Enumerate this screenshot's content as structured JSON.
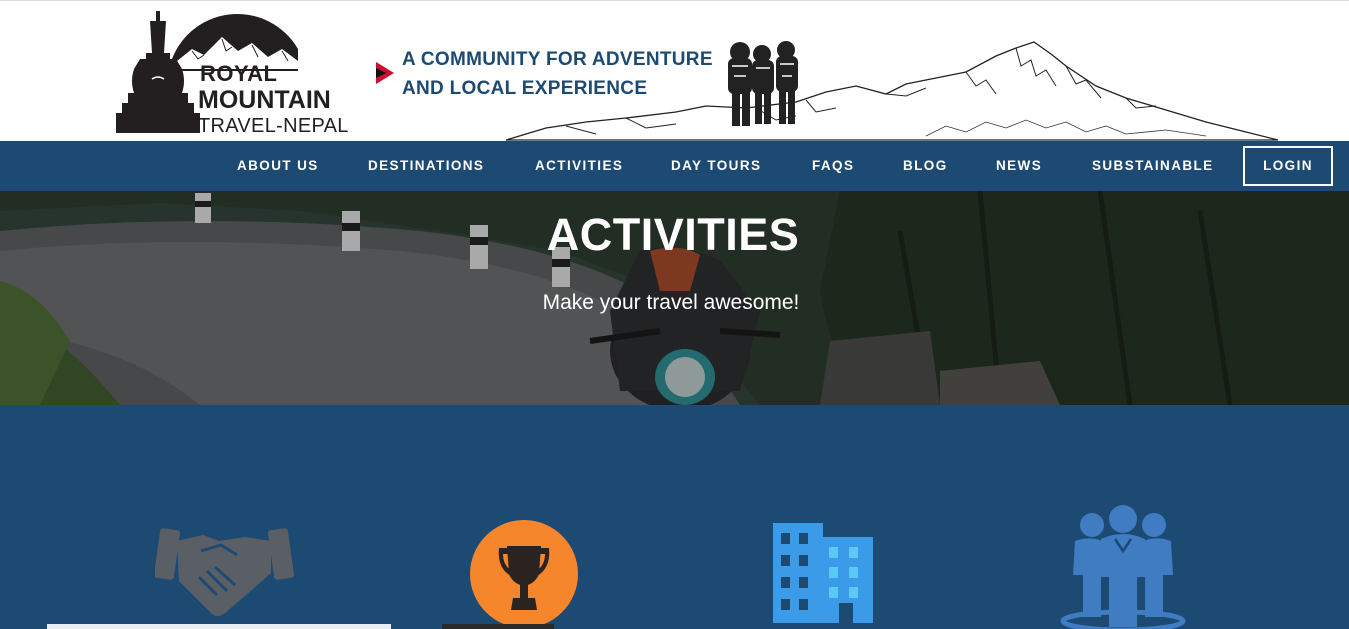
{
  "logo": {
    "line1": "ROYAL",
    "line2": "MOUNTAIN",
    "line3": "TRAVEL-NEPAL"
  },
  "tagline": {
    "line1": "A COMMUNITY FOR ADVENTURE",
    "line2": "AND LOCAL EXPERIENCE"
  },
  "nav": {
    "items": [
      {
        "label": "ABOUT US"
      },
      {
        "label": "DESTINATIONS"
      },
      {
        "label": "ACTIVITIES"
      },
      {
        "label": "DAY TOURS"
      },
      {
        "label": "FAQS"
      },
      {
        "label": "BLOG"
      },
      {
        "label": "NEWS"
      },
      {
        "label": "SUBSTAINABLE"
      }
    ],
    "login_label": "LOGIN"
  },
  "hero": {
    "title": "ACTIVITIES",
    "subtitle": "Make your travel awesome!"
  },
  "activities": {
    "icons": [
      "handshake-icon",
      "trophy-icon",
      "building-icon",
      "group-icon"
    ]
  },
  "colors": {
    "brand_blue": "#1d4a73",
    "accent_red": "#c8102e",
    "trophy_orange": "#f5862b",
    "building_blue": "#3b9be8"
  }
}
